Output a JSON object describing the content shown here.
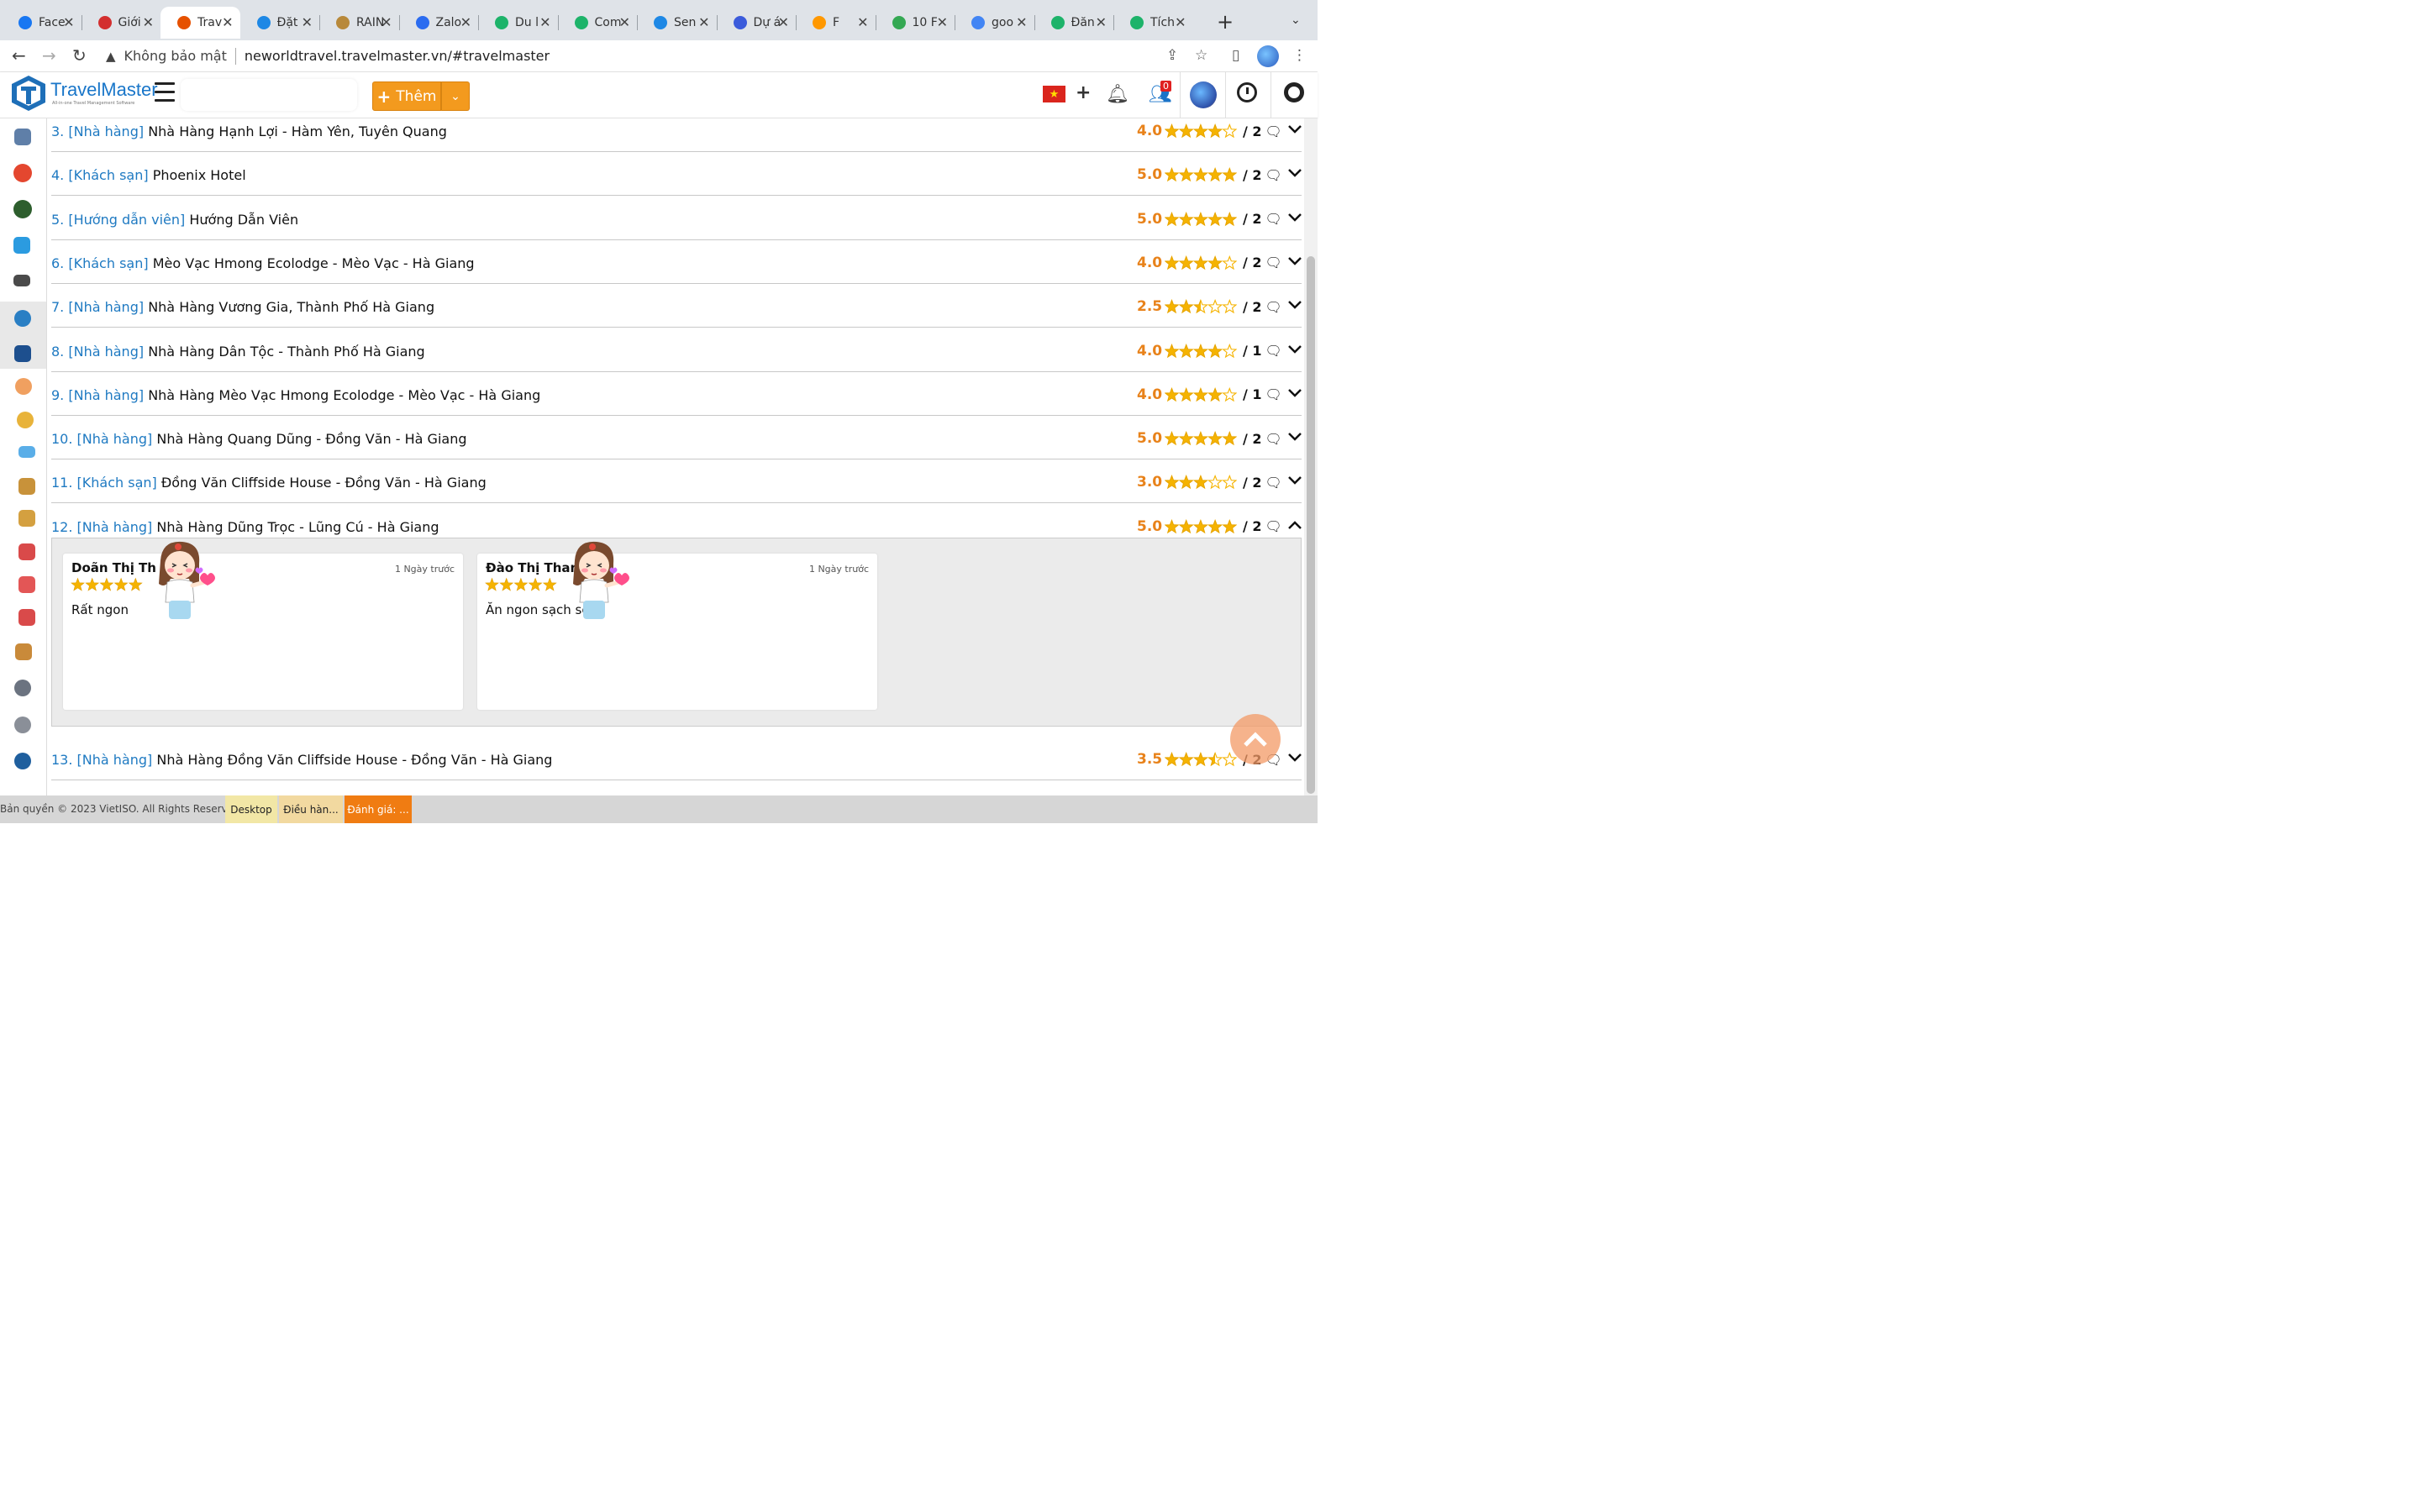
{
  "browser": {
    "tabs": [
      {
        "label": "Face",
        "color": "#1877f2"
      },
      {
        "label": "Giới",
        "color": "#d32f2f"
      },
      {
        "label": "Trav",
        "color": "#e65100"
      },
      {
        "label": "Đặt",
        "color": "#1e88e5"
      },
      {
        "label": "RAIN",
        "color": "#b8893a"
      },
      {
        "label": "Zalo",
        "color": "#2b6cf0"
      },
      {
        "label": "Du l",
        "color": "#1db36a"
      },
      {
        "label": "Com",
        "color": "#1db36a"
      },
      {
        "label": "Sen",
        "color": "#1e88e5"
      },
      {
        "label": "Dự á",
        "color": "#3b5bdb"
      },
      {
        "label": "F",
        "color": "#ff9800"
      },
      {
        "label": "10 F",
        "color": "#34a853"
      },
      {
        "label": "goo",
        "color": "#4285f4"
      },
      {
        "label": "Đăn",
        "color": "#1db36a"
      },
      {
        "label": "Tích",
        "color": "#1db36a"
      }
    ],
    "active_tab": 2,
    "security_label": "Không bảo mật",
    "url": "neworldtravel.travelmaster.vn/#travelmaster"
  },
  "header": {
    "brand": "TravelMaster",
    "brand_sub": "All-in-one Travel Management Software",
    "add_label": "Thêm",
    "notification_count": "0",
    "flag_symbol": "★"
  },
  "reviews": [
    {
      "num": "3.",
      "category": "[Nhà hàng]",
      "name": "Nhà Hàng Hạnh Lợi - Hàm Yên, Tuyên Quang",
      "score": "4.0",
      "rating": 4.0,
      "count": "/ 2",
      "expanded": false
    },
    {
      "num": "4.",
      "category": "[Khách sạn]",
      "name": "Phoenix Hotel",
      "score": "5.0",
      "rating": 5.0,
      "count": "/ 2",
      "expanded": false
    },
    {
      "num": "5.",
      "category": "[Hướng dẫn viên]",
      "name": "Hướng Dẫn Viên",
      "score": "5.0",
      "rating": 5.0,
      "count": "/ 2",
      "expanded": false
    },
    {
      "num": "6.",
      "category": "[Khách sạn]",
      "name": "Mèo Vạc Hmong Ecolodge - Mèo Vạc - Hà Giang",
      "score": "4.0",
      "rating": 4.0,
      "count": "/ 2",
      "expanded": false
    },
    {
      "num": "7.",
      "category": "[Nhà hàng]",
      "name": "Nhà Hàng Vương Gia, Thành Phố Hà Giang",
      "score": "2.5",
      "rating": 2.5,
      "count": "/ 2",
      "expanded": false
    },
    {
      "num": "8.",
      "category": "[Nhà hàng]",
      "name": "Nhà Hàng Dân Tộc - Thành Phố Hà Giang",
      "score": "4.0",
      "rating": 4.0,
      "count": "/ 1",
      "expanded": false
    },
    {
      "num": "9.",
      "category": "[Nhà hàng]",
      "name": "Nhà Hàng Mèo Vạc Hmong Ecolodge - Mèo Vạc - Hà Giang",
      "score": "4.0",
      "rating": 4.0,
      "count": "/ 1",
      "expanded": false
    },
    {
      "num": "10.",
      "category": "[Nhà hàng]",
      "name": "Nhà Hàng Quang Dũng - Đồng Văn - Hà Giang",
      "score": "5.0",
      "rating": 5.0,
      "count": "/ 2",
      "expanded": false
    },
    {
      "num": "11.",
      "category": "[Khách sạn]",
      "name": "Đồng Văn Cliffside House - Đồng Văn - Hà Giang",
      "score": "3.0",
      "rating": 3.0,
      "count": "/ 2",
      "expanded": false
    },
    {
      "num": "12.",
      "category": "[Nhà hàng]",
      "name": "Nhà Hàng Dũng Trọc - Lũng Cú - Hà Giang",
      "score": "5.0",
      "rating": 5.0,
      "count": "/ 2",
      "expanded": true
    },
    {
      "num": "13.",
      "category": "[Nhà hàng]",
      "name": "Nhà Hàng Đồng Văn Cliffside House - Đồng Văn - Hà Giang",
      "score": "3.5",
      "rating": 3.5,
      "count": "/ 2",
      "expanded": false
    }
  ],
  "expanded_comments": [
    {
      "author": "Doãn Thị Th",
      "ago": "1 Ngày trước",
      "stars": 5,
      "text": "Rất ngon"
    },
    {
      "author": "Đào Thị Than",
      "ago": "1 Ngày trước",
      "stars": 5,
      "text": "Ăn ngon sạch sẽ"
    }
  ],
  "footer": {
    "copyright": "Bản quyền © 2023 VietISO. All Rights Reserved.",
    "tabs": [
      {
        "label": "Desktop",
        "bg": "#f2e7a6",
        "color": "#222"
      },
      {
        "label": "Điều hàn...",
        "bg": "#f2d9a0",
        "color": "#222"
      },
      {
        "label": "Đánh giá: ...",
        "bg": "#f07c12",
        "color": "#fff"
      }
    ]
  },
  "colors": {
    "accent": "#1f7ac2",
    "score": "#e8821a",
    "star": "#f5b301",
    "add_button": "#f39a1e"
  }
}
